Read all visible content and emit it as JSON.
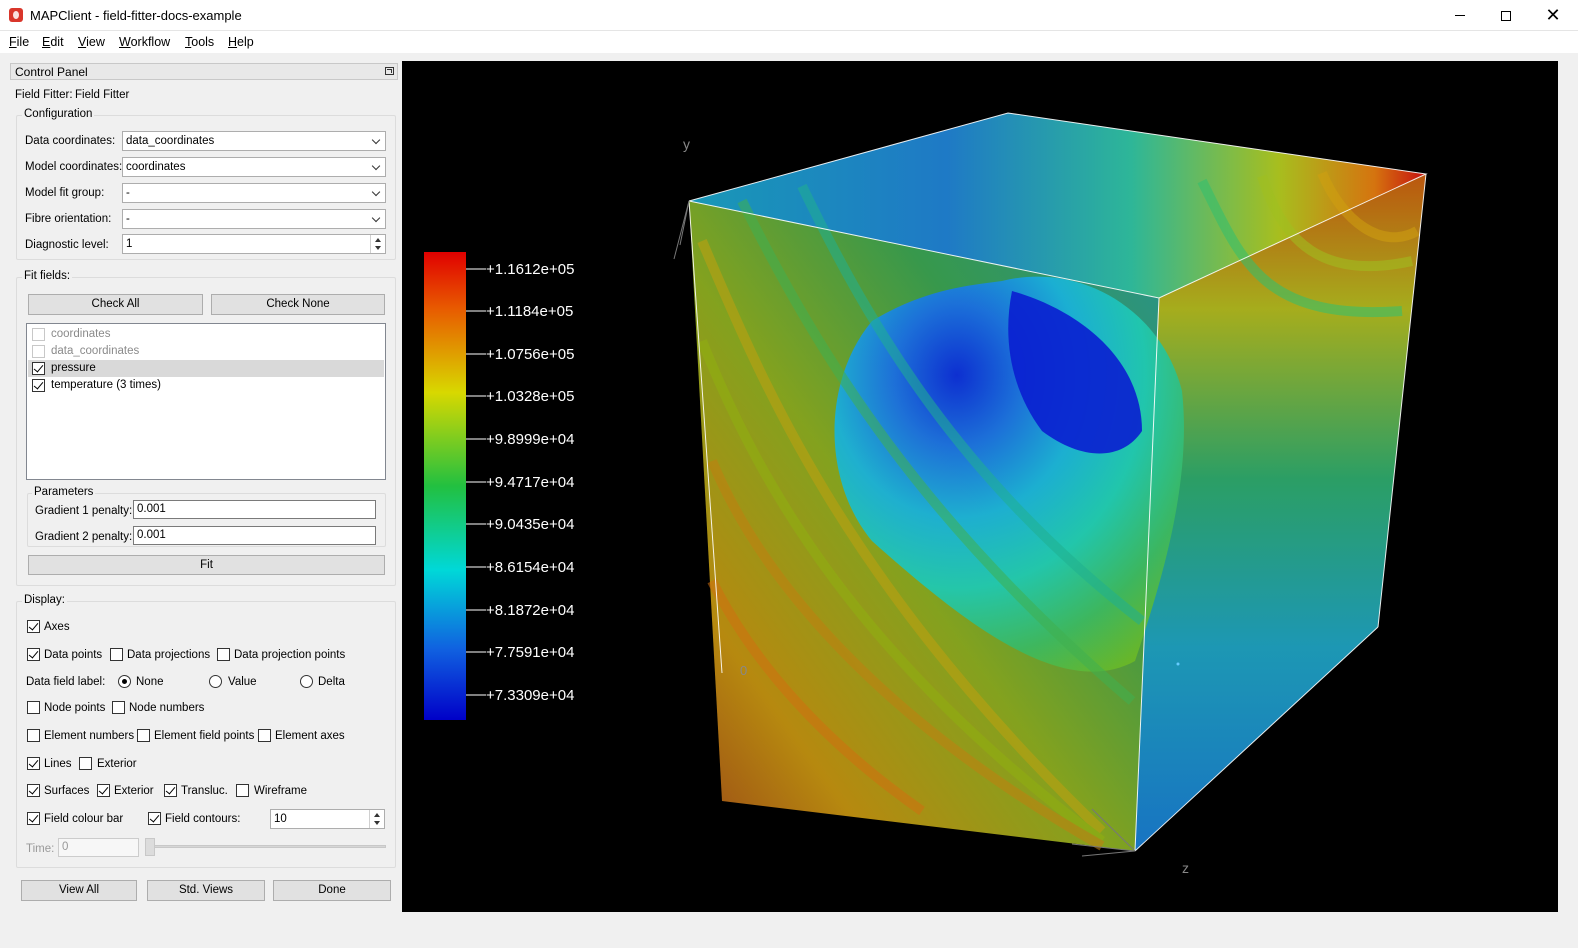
{
  "window": {
    "title": "MAPClient - field-fitter-docs-example",
    "minimize": "—",
    "maximize": "☐",
    "close": "✕"
  },
  "menu": [
    "File",
    "Edit",
    "View",
    "Workflow",
    "Tools",
    "Help"
  ],
  "panel": {
    "title": "Control Panel",
    "step_label": "Field Fitter:",
    "step_value": "Field Fitter",
    "configuration": {
      "title": "Configuration",
      "data_coordinates_label": "Data coordinates:",
      "data_coordinates_value": "data_coordinates",
      "model_coordinates_label": "Model coordinates:",
      "model_coordinates_value": "coordinates",
      "model_fit_group_label": "Model fit group:",
      "model_fit_group_value": "-",
      "fibre_orientation_label": "Fibre orientation:",
      "fibre_orientation_value": "-",
      "diagnostic_level_label": "Diagnostic level:",
      "diagnostic_level_value": "1"
    },
    "fit_fields": {
      "title": "Fit fields:",
      "check_all": "Check All",
      "check_none": "Check None",
      "fields": [
        {
          "label": "coordinates",
          "checked": false,
          "enabled": false
        },
        {
          "label": "data_coordinates",
          "checked": false,
          "enabled": false
        },
        {
          "label": "pressure",
          "checked": true,
          "enabled": true
        },
        {
          "label": "temperature (3 times)",
          "checked": true,
          "enabled": true
        }
      ],
      "parameters_title": "Parameters",
      "gradient1_label": "Gradient 1 penalty:",
      "gradient1_value": "0.001",
      "gradient2_label": "Gradient 2 penalty:",
      "gradient2_value": "0.001",
      "fit_button": "Fit"
    },
    "display": {
      "title": "Display:",
      "axes": "Axes",
      "data_points": "Data points",
      "data_projections": "Data projections",
      "data_projection_points": "Data projection points",
      "data_field_label": "Data field label:",
      "radio_none": "None",
      "radio_value": "Value",
      "radio_delta": "Delta",
      "node_points": "Node points",
      "node_numbers": "Node numbers",
      "element_numbers": "Element numbers",
      "element_field_points": "Element field points",
      "element_axes": "Element axes",
      "lines": "Lines",
      "lines_exterior": "Exterior",
      "surfaces": "Surfaces",
      "surfaces_exterior": "Exterior",
      "transluc": "Transluc.",
      "wireframe": "Wireframe",
      "field_colour_bar": "Field colour bar",
      "field_contours": "Field contours:",
      "field_contours_value": "10",
      "time_label": "Time:",
      "time_value": "0"
    },
    "buttons": {
      "view_all": "View All",
      "std_views": "Std. Views",
      "done": "Done"
    }
  },
  "viewport": {
    "colorbar_ticks": [
      "+1.1612e+05",
      "+1.1184e+05",
      "+1.0756e+05",
      "+1.0328e+05",
      "+9.8999e+04",
      "+9.4717e+04",
      "+9.0435e+04",
      "+8.6154e+04",
      "+8.1872e+04",
      "+7.7591e+04",
      "+7.3309e+04"
    ],
    "axis_y": "y",
    "axis_z": "z",
    "axis_x": "x",
    "origin_label": "0"
  }
}
